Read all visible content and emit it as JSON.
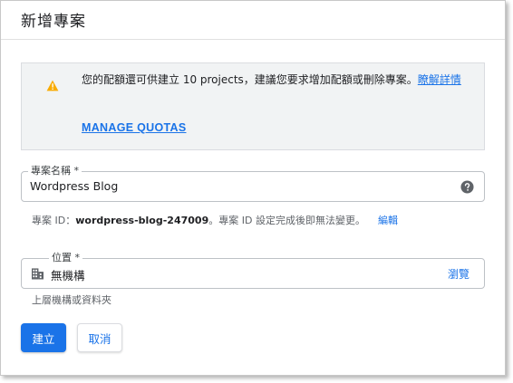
{
  "dialog": {
    "title": "新增專案"
  },
  "notice": {
    "icon": "warning-icon",
    "icon_color": "#f9ab00",
    "text": "您的配額還可供建立 10 projects，建議您要求增加配額或刪除專案。",
    "details_link": "瞭解詳情",
    "manage_quotas": "MANAGE QUOTAS"
  },
  "project_name": {
    "label": "專案名稱 *",
    "value": "Wordpress Blog",
    "help_icon": "help-icon"
  },
  "project_id": {
    "prefix": "專案 ID：",
    "id": "wordpress-blog-247009",
    "suffix": "。專案 ID 設定完成後即無法變更。",
    "edit": "編輯"
  },
  "location": {
    "label": "位置 *",
    "icon": "building-icon",
    "value": "無機構",
    "browse": "瀏覽",
    "hint": "上層機構或資料夾"
  },
  "buttons": {
    "create": "建立",
    "cancel": "取消"
  },
  "colors": {
    "accent": "#1a73e8",
    "warning": "#f9ab00"
  }
}
